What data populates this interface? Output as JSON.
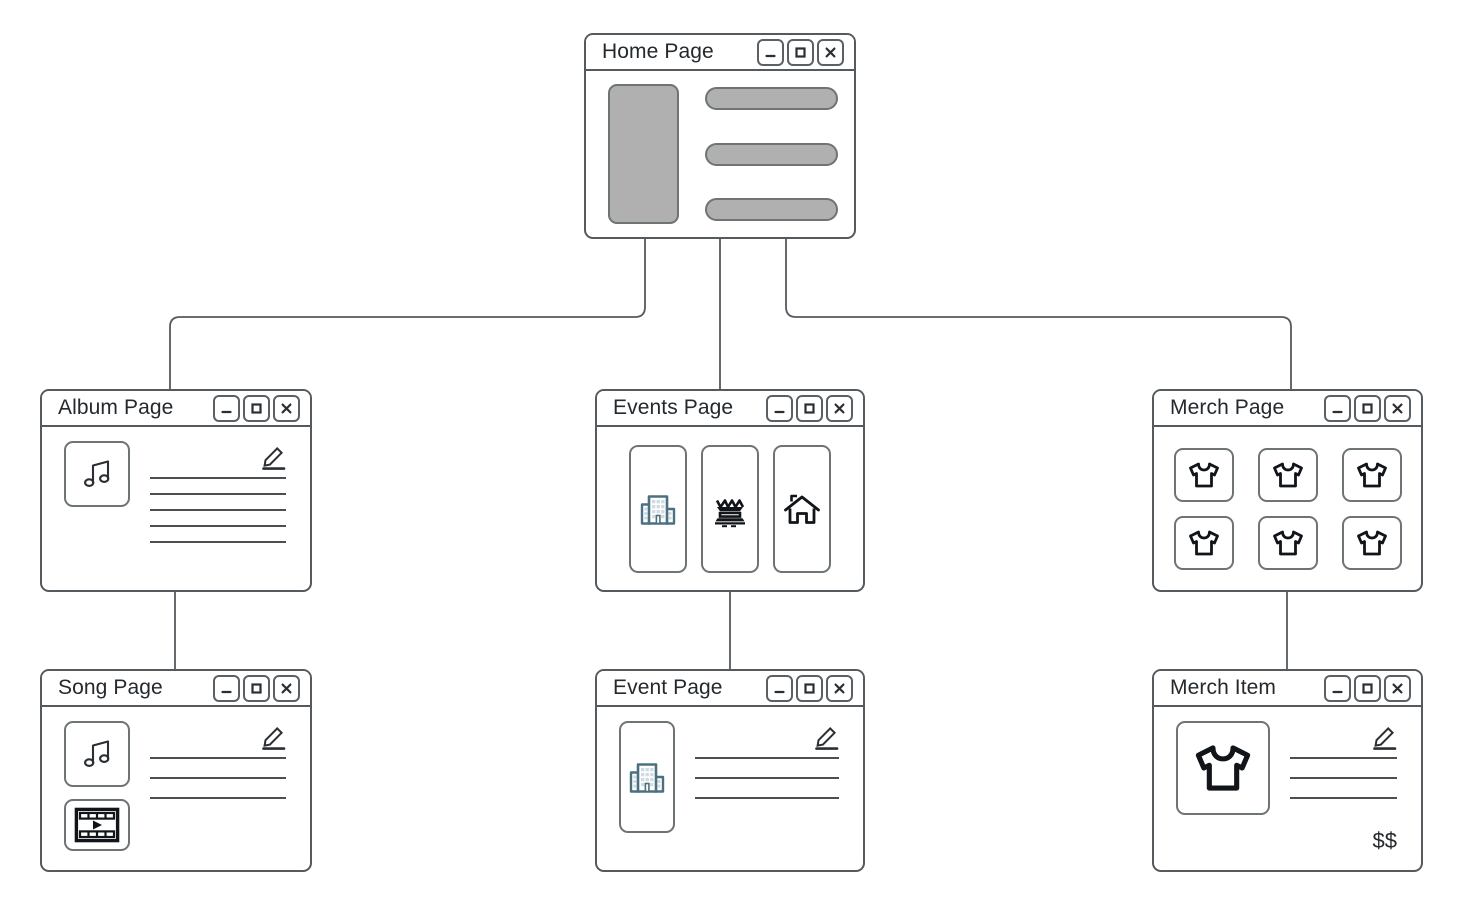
{
  "diagram": {
    "title": "Site map diagram",
    "stroke_color": "#555a5e",
    "accent_color": "#4a7081",
    "placeholder_gray": "#b0b0b0"
  },
  "window_controls": {
    "minimize_label": "_",
    "maximize_label": "□",
    "close_label": "×",
    "minimize_name": "minimize-button",
    "maximize_name": "maximize-button",
    "close_name": "close-button"
  },
  "nodes": {
    "home": {
      "title": "Home Page",
      "icons": [
        "hero-placeholder",
        "content-bar",
        "content-bar",
        "content-bar"
      ],
      "bars": 3
    },
    "album": {
      "title": "Album Page",
      "icons": [
        "music-note-icon",
        "pencil-edit-icon"
      ],
      "text_lines": 5
    },
    "events": {
      "title": "Events Page",
      "icons": [
        "city-buildings-icon",
        "stadium-icon",
        "house-icon"
      ],
      "tiles": 3
    },
    "merch": {
      "title": "Merch Page",
      "icons": [
        "tshirt-icon",
        "tshirt-icon",
        "tshirt-icon",
        "tshirt-icon",
        "tshirt-icon",
        "tshirt-icon"
      ],
      "tiles": 6
    },
    "song": {
      "title": "Song Page",
      "icons": [
        "music-note-icon",
        "film-play-icon",
        "pencil-edit-icon"
      ],
      "text_lines": 3
    },
    "event": {
      "title": "Event Page",
      "icons": [
        "city-buildings-icon",
        "pencil-edit-icon"
      ],
      "text_lines": 3
    },
    "merch_item": {
      "title": "Merch Item",
      "icons": [
        "tshirt-icon",
        "pencil-edit-icon"
      ],
      "text_lines": 3,
      "price": "$$"
    }
  },
  "edges": [
    {
      "from": "home",
      "to": "album"
    },
    {
      "from": "home",
      "to": "events"
    },
    {
      "from": "home",
      "to": "merch"
    },
    {
      "from": "album",
      "to": "song"
    },
    {
      "from": "events",
      "to": "event"
    },
    {
      "from": "merch",
      "to": "merch_item"
    }
  ]
}
